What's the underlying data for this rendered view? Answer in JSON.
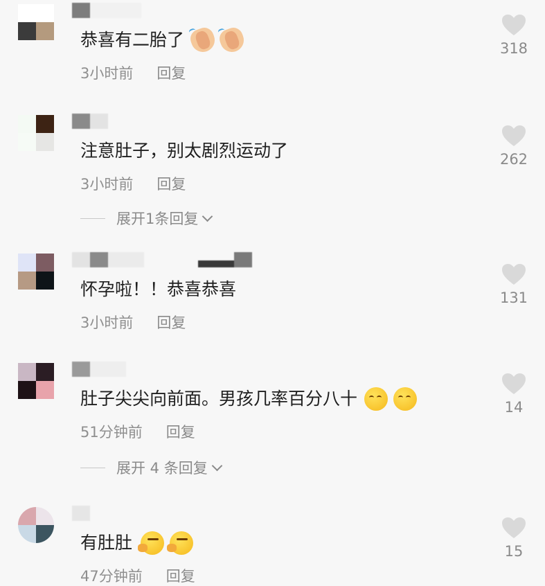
{
  "comments": [
    {
      "text": "恭喜有二胎了",
      "emojis": [
        "clapping-hands",
        "clapping-hands"
      ],
      "time": "3小时前",
      "reply_label": "回复",
      "likes": "318",
      "expand_label": ""
    },
    {
      "text": "注意肚子，别太剧烈运动了",
      "emojis": [],
      "time": "3小时前",
      "reply_label": "回复",
      "likes": "262",
      "expand_label": "展开1条回复"
    },
    {
      "text": "怀孕啦！！恭喜恭喜",
      "emojis": [],
      "time": "3小时前",
      "reply_label": "回复",
      "likes": "131",
      "expand_label": ""
    },
    {
      "text": "肚子尖尖向前面。男孩几率百分八十",
      "emojis": [
        "smirking-face",
        "smirking-face"
      ],
      "time": "51分钟前",
      "reply_label": "回复",
      "likes": "14",
      "expand_label": "展开 4 条回复"
    },
    {
      "text": "有肚肚",
      "emojis": [
        "thinking-face",
        "thinking-face"
      ],
      "time": "47分钟前",
      "reply_label": "回复",
      "likes": "15",
      "expand_label": ""
    }
  ],
  "colors": {
    "background": "#f7f7f7",
    "text": "#1f1f1f",
    "meta": "#8f8f8f",
    "heart": "#d9d9d9"
  }
}
